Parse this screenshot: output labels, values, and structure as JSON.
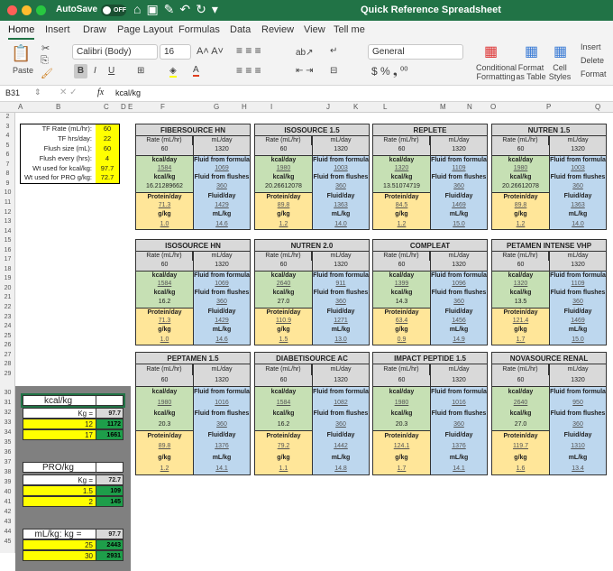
{
  "window": {
    "autosave_label": "AutoSave",
    "autosave_state": "OFF",
    "title": "Quick Reference Spreadsheet",
    "traffic_colors": [
      "#fe5f57",
      "#febc2e",
      "#28c840"
    ]
  },
  "tabs": [
    "Home",
    "Insert",
    "Draw",
    "Page Layout",
    "Formulas",
    "Data",
    "Review",
    "View",
    "Tell me"
  ],
  "ribbon": {
    "paste": "Paste",
    "font": "Calibri (Body)",
    "size": "16",
    "number_format": "General",
    "conditional": "Conditional Formatting",
    "format_table": "Format as Table",
    "cell_styles": "Cell Styles",
    "insert": "Insert",
    "delete": "Delete",
    "format": "Format"
  },
  "formula_bar": {
    "cell": "B31",
    "fx": "fx",
    "value": "kcal/kg"
  },
  "columns": [
    "A",
    "B",
    "C",
    "D",
    "E",
    "F",
    "G",
    "H",
    "I",
    "J",
    "K",
    "L",
    "M",
    "N",
    "O",
    "P",
    "Q"
  ],
  "params": [
    {
      "label": "TF Rate (mL/hr):",
      "value": "60"
    },
    {
      "label": "TF hrs/day:",
      "value": "22"
    },
    {
      "label": "Flush size (mL):",
      "value": "60"
    },
    {
      "label": "Flush every (hrs):",
      "value": "4"
    },
    {
      "label": "Wt used for kcal/kg:",
      "value": "97.7"
    },
    {
      "label": "Wt used for PRO g/kg:",
      "value": "72.7"
    }
  ],
  "labels": {
    "rate": "Rate (mL/hr)",
    "ml_day": "mL/day",
    "kcal_day": "kcal/day",
    "fluid_formula": "Fluid from formula",
    "kcal_kg": "kcal/kg",
    "fluid_flushes": "Fluid from flushes",
    "protein_day": "Protein/day",
    "fluid_day": "Fluid/day",
    "g_kg": "g/kg",
    "ml_kg": "mL/kg"
  },
  "formulas": [
    {
      "name": "FIBERSOURCE HN",
      "rate": "60",
      "ml_day": "1320",
      "kcal_day": "1584",
      "fluid_formula": "1069",
      "kcal_kg": "16.21289662",
      "fluid_flushes": "360",
      "protein_day": "71.3",
      "fluid_day": "1429",
      "g_kg": "1.0",
      "ml_kg": "14.6"
    },
    {
      "name": "ISOSOURCE 1.5",
      "rate": "60",
      "ml_day": "1320",
      "kcal_day": "1980",
      "fluid_formula": "1003",
      "kcal_kg": "20.26612078",
      "fluid_flushes": "360",
      "protein_day": "89.8",
      "fluid_day": "1363",
      "g_kg": "1.2",
      "ml_kg": "14.0"
    },
    {
      "name": "REPLETE",
      "rate": "60",
      "ml_day": "1320",
      "kcal_day": "1320",
      "fluid_formula": "1109",
      "kcal_kg": "13.51074719",
      "fluid_flushes": "360",
      "protein_day": "84.5",
      "fluid_day": "1469",
      "g_kg": "1.2",
      "ml_kg": "15.0"
    },
    {
      "name": "NUTREN 1.5",
      "rate": "60",
      "ml_day": "1320",
      "kcal_day": "1980",
      "fluid_formula": "1003",
      "kcal_kg": "20.26612078",
      "fluid_flushes": "360",
      "protein_day": "89.8",
      "fluid_day": "1363",
      "g_kg": "1.2",
      "ml_kg": "14.0"
    },
    {
      "name": "ISOSOURCE HN",
      "rate": "60",
      "ml_day": "1320",
      "kcal_day": "1584",
      "fluid_formula": "1069",
      "kcal_kg": "16.2",
      "fluid_flushes": "360",
      "protein_day": "71.3",
      "fluid_day": "1429",
      "g_kg": "1.0",
      "ml_kg": "14.6"
    },
    {
      "name": "NUTREN 2.0",
      "rate": "60",
      "ml_day": "1320",
      "kcal_day": "2640",
      "fluid_formula": "911",
      "kcal_kg": "27.0",
      "fluid_flushes": "360",
      "protein_day": "110.9",
      "fluid_day": "1271",
      "g_kg": "1.5",
      "ml_kg": "13.0"
    },
    {
      "name": "COMPLEAT",
      "rate": "60",
      "ml_day": "1320",
      "kcal_day": "1399",
      "fluid_formula": "1096",
      "kcal_kg": "14.3",
      "fluid_flushes": "360",
      "protein_day": "63.4",
      "fluid_day": "1456",
      "g_kg": "0.9",
      "ml_kg": "14.9"
    },
    {
      "name": "PETAMEN INTENSE VHP",
      "rate": "60",
      "ml_day": "1320",
      "kcal_day": "1320",
      "fluid_formula": "1109",
      "kcal_kg": "13.5",
      "fluid_flushes": "360",
      "protein_day": "121.4",
      "fluid_day": "1469",
      "g_kg": "1.7",
      "ml_kg": "15.0"
    },
    {
      "name": "PEPTAMEN 1.5",
      "rate": "60",
      "ml_day": "1320",
      "kcal_day": "1980",
      "fluid_formula": "1016",
      "kcal_kg": "20.3",
      "fluid_flushes": "360",
      "protein_day": "89.8",
      "fluid_day": "1376",
      "g_kg": "1.2",
      "ml_kg": "14.1"
    },
    {
      "name": "DIABETISOURCE AC",
      "rate": "60",
      "ml_day": "1320",
      "kcal_day": "1584",
      "fluid_formula": "1082",
      "kcal_kg": "16.2",
      "fluid_flushes": "360",
      "protein_day": "79.2",
      "fluid_day": "1442",
      "g_kg": "1.1",
      "ml_kg": "14.8"
    },
    {
      "name": "IMPACT PEPTIDE 1.5",
      "rate": "60",
      "ml_day": "1320",
      "kcal_day": "1980",
      "fluid_formula": "1016",
      "kcal_kg": "20.3",
      "fluid_flushes": "360",
      "protein_day": "124.1",
      "fluid_day": "1376",
      "g_kg": "1.7",
      "ml_kg": "14.1"
    },
    {
      "name": "NOVASOURCE RENAL",
      "rate": "60",
      "ml_day": "1320",
      "kcal_day": "2640",
      "fluid_formula": "950",
      "kcal_kg": "27.0",
      "fluid_flushes": "360",
      "protein_day": "119.7",
      "fluid_day": "1310",
      "g_kg": "1.6",
      "ml_kg": "13.4"
    }
  ],
  "calculator": {
    "kcal_title": "kcal/kg",
    "kg_label": "Kg =",
    "kcal_kg_value": "97.7",
    "kcal_rows": [
      {
        "factor": "12",
        "result": "1172"
      },
      {
        "factor": "17",
        "result": "1661"
      }
    ],
    "pro_title": "PRO/kg",
    "pro_kg_value": "72.7",
    "pro_rows": [
      {
        "factor": "1.5",
        "result": "109"
      },
      {
        "factor": "2",
        "result": "145"
      }
    ],
    "ml_title": "mL/kg: kg =",
    "ml_kg_value": "97.7",
    "ml_rows": [
      {
        "factor": "25",
        "result": "2443"
      },
      {
        "factor": "30",
        "result": "2931"
      }
    ]
  }
}
